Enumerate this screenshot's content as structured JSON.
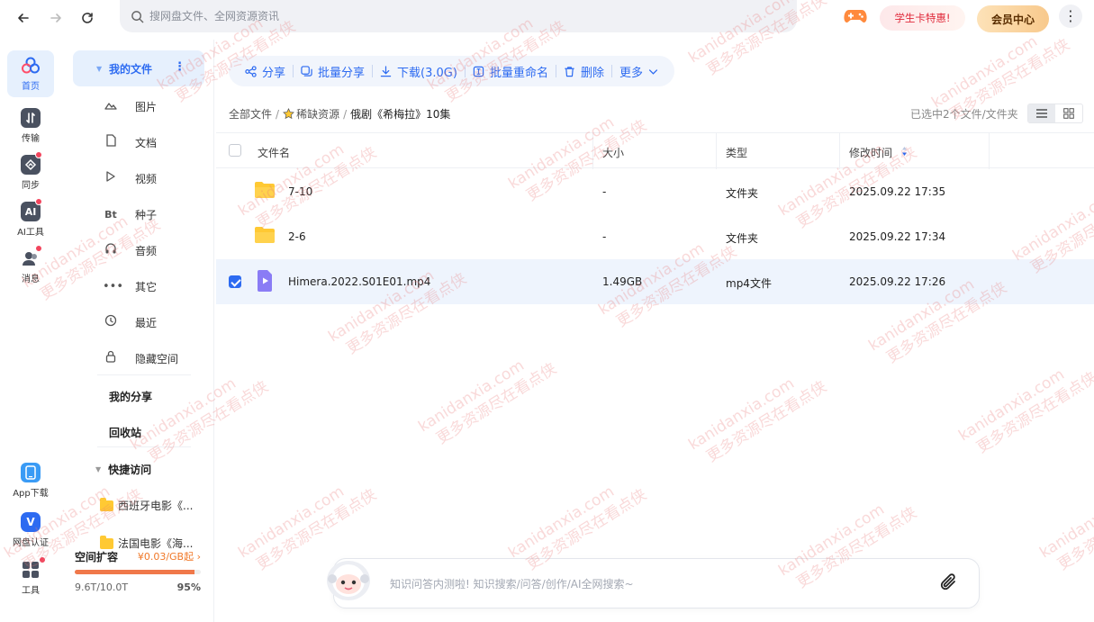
{
  "search": {
    "placeholder": "搜网盘文件、全网资源资讯"
  },
  "topbar": {
    "student_label": "学生卡特惠!",
    "vip_label": "会员中心",
    "more_label": "⋮"
  },
  "rail": {
    "items": [
      {
        "label": "首页",
        "icon": "home-icon",
        "active": true
      },
      {
        "label": "传输",
        "icon": "transfer-icon"
      },
      {
        "label": "同步",
        "icon": "sync-icon",
        "badge": true
      },
      {
        "label": "AI工具",
        "icon": "ai-icon",
        "badge": true
      },
      {
        "label": "消息",
        "icon": "message-icon",
        "badge": true
      },
      {
        "label": "App下载",
        "icon": "app-download-icon"
      },
      {
        "label": "网盘认证",
        "icon": "verify-icon"
      },
      {
        "label": "工具",
        "icon": "tools-icon",
        "badge": true
      }
    ]
  },
  "side": {
    "my_files": "我的文件",
    "items": [
      {
        "label": "图片",
        "icon": "image-icon"
      },
      {
        "label": "文档",
        "icon": "document-icon"
      },
      {
        "label": "视频",
        "icon": "video-icon"
      },
      {
        "label": "种子",
        "icon": "torrent-icon",
        "glyph": "Bt"
      },
      {
        "label": "音频",
        "icon": "audio-icon"
      },
      {
        "label": "其它",
        "icon": "other-icon"
      },
      {
        "label": "最近",
        "icon": "recent-icon"
      },
      {
        "label": "隐藏空间",
        "icon": "lock-icon"
      }
    ],
    "my_share": "我的分享",
    "recycle": "回收站",
    "quick_access": "快捷访问",
    "quick_items": [
      {
        "label": "西班牙电影《..."
      },
      {
        "label": "法国电影《海..."
      }
    ],
    "space": {
      "title": "空间扩容",
      "price": "¥0.03/GB起 ›",
      "used": "9.6T/10.0T",
      "percent": "95%",
      "fraction": 0.95
    }
  },
  "toolbar": {
    "share": "分享",
    "batch_share": "批量分享",
    "download": "下载(3.0G)",
    "batch_rename": "批量重命名",
    "delete": "删除",
    "more": "更多"
  },
  "breadcrumb": {
    "root": "全部文件",
    "sep": "/",
    "level1": "稀缺资源",
    "current": "俄剧《希梅拉》10集"
  },
  "selection_info": "已选中2个文件/文件夹",
  "table": {
    "headers": {
      "name": "文件名",
      "size": "大小",
      "type": "类型",
      "modified": "修改时间"
    },
    "rows": [
      {
        "name": "7-10",
        "size": "-",
        "type": "文件夹",
        "modified": "2025.09.22 17:35",
        "kind": "folder",
        "checked": false
      },
      {
        "name": "2-6",
        "size": "-",
        "type": "文件夹",
        "modified": "2025.09.22 17:34",
        "kind": "folder",
        "checked": false
      },
      {
        "name": "Himera.2022.S01E01.mp4",
        "size": "1.49GB",
        "type": "mp4文件",
        "modified": "2025.09.22 17:26",
        "kind": "video",
        "checked": true
      }
    ]
  },
  "ai_search": {
    "placeholder": "知识问答内测啦! 知识搜索/问答/创作/AI全网搜索~"
  },
  "watermark": {
    "line1": "kanidanxia.com",
    "line2": "更多资源尽在看点侠"
  },
  "colors": {
    "accent": "#2d6bf1",
    "folder": "#ffc933",
    "badge": "#f2455d",
    "vip": "#f8c98c"
  }
}
